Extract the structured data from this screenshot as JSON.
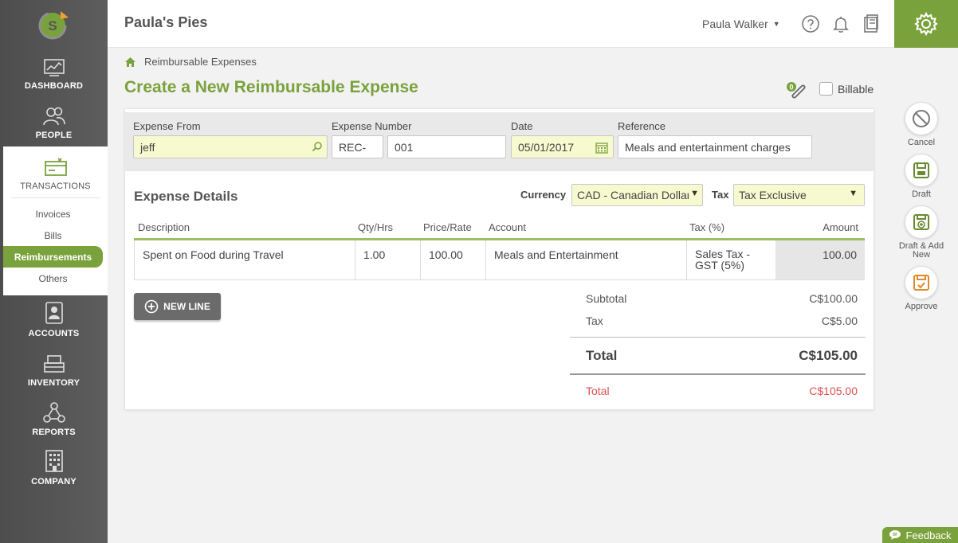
{
  "sidebar": {
    "items": [
      {
        "label": "DASHBOARD",
        "icon": "dashboard-icon"
      },
      {
        "label": "PEOPLE",
        "icon": "people-icon"
      },
      {
        "label": "TRANSACTIONS",
        "icon": "transactions-icon"
      },
      {
        "label": "ACCOUNTS",
        "icon": "accounts-icon"
      },
      {
        "label": "INVENTORY",
        "icon": "inventory-icon"
      },
      {
        "label": "REPORTS",
        "icon": "reports-icon"
      },
      {
        "label": "COMPANY",
        "icon": "company-icon"
      }
    ],
    "transactions_submenu": [
      "Invoices",
      "Bills",
      "Reimbursements",
      "Others"
    ],
    "active_submenu": "Reimbursements"
  },
  "header": {
    "company": "Paula's Pies",
    "user": "Paula Walker"
  },
  "breadcrumb": "Reimbursable Expenses",
  "page_title": "Create a New Reimbursable Expense",
  "attachments_count": "0",
  "billable_label": "Billable",
  "form": {
    "expense_from_label": "Expense From",
    "expense_from_value": "jeff",
    "expense_number_label": "Expense Number",
    "expense_prefix": "REC-",
    "expense_number": "001",
    "date_label": "Date",
    "date_value": "05/01/2017",
    "reference_label": "Reference",
    "reference_value": "Meals and entertainment charges"
  },
  "details": {
    "title": "Expense Details",
    "currency_label": "Currency",
    "currency_value": "CAD - Canadian Dollar",
    "tax_label": "Tax",
    "tax_value": "Tax Exclusive",
    "columns": {
      "description": "Description",
      "qty": "Qty/Hrs",
      "price": "Price/Rate",
      "account": "Account",
      "tax": "Tax (%)",
      "amount": "Amount"
    },
    "line": {
      "description": "Spent on Food during Travel",
      "qty": "1.00",
      "price": "100.00",
      "account": "Meals and Entertainment",
      "tax": "Sales Tax - GST (5%)",
      "amount": "100.00"
    },
    "new_line_label": "NEW LINE"
  },
  "summary": {
    "subtotal_label": "Subtotal",
    "subtotal_value": "C$100.00",
    "tax_label": "Tax",
    "tax_value": "C$5.00",
    "total_label": "Total",
    "total_value": "C$105.00",
    "total2_label": "Total",
    "total2_value": "C$105.00"
  },
  "actions": {
    "cancel": "Cancel",
    "draft": "Draft",
    "draft_add_new": "Draft & Add New",
    "approve": "Approve"
  },
  "feedback_label": "Feedback",
  "colors": {
    "brand_green": "#7aa23c",
    "input_yellow": "#f7f9cf",
    "red_total": "#d9534f"
  }
}
